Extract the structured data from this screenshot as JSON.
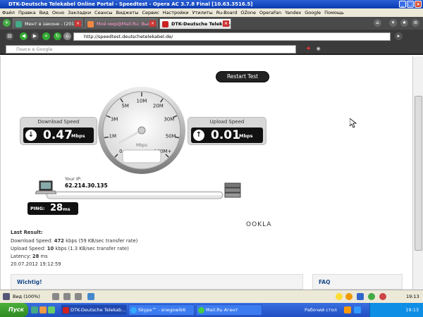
{
  "window": {
    "title": "DTK-Deutsche Telekabel Online Portal - Speedtest - Opera AC 3.7.8 Final [10.63.3516.5]"
  },
  "menu": [
    "Файл",
    "Правка",
    "Вид",
    "Окно",
    "Закладки",
    "Сеансы",
    "Виджеты",
    "Сервис",
    "Настройки",
    "Утилиты",
    "Ru-Board",
    "OZone",
    "OperaFan",
    "Yandex",
    "Google",
    "Помощь"
  ],
  "tabs": [
    {
      "label": "Мент в законе - (2010-..."
    },
    {
      "label": "Мой мир@Mail.Ru: Высок..."
    },
    {
      "label": "DTK-Deutsche Telekab..."
    }
  ],
  "address": {
    "url": "http://speedtest.deutschetelekabel.de/"
  },
  "search": {
    "placeholder": "Поиск в Google"
  },
  "speedtest": {
    "restart_label": "Restart Test",
    "download": {
      "label": "Download Speed",
      "value": "0.47",
      "unit": "Mbps"
    },
    "upload": {
      "label": "Upload Speed",
      "value": "0.01",
      "unit": "Mbps"
    },
    "gauge": {
      "ticks": [
        "0",
        "1M",
        "3M",
        "5M",
        "10M",
        "20M",
        "30M",
        "50M",
        "100M+"
      ],
      "unit": "Mbps",
      "needle_value": 0.47
    },
    "ip_label": "Your IP:",
    "ip": "62.214.30.135",
    "ping_label": "PING:",
    "ping_value": "28",
    "ping_unit": "ms",
    "brand": "OOKLA"
  },
  "result": {
    "title": "Last Result:",
    "download_prefix": "Download Speed:",
    "download_value": "472",
    "download_suffix": "kbps (59 KB/sec transfer rate)",
    "upload_prefix": "Upload Speed:",
    "upload_value": "10",
    "upload_suffix": "kbps (1.3 KB/sec transfer rate)",
    "latency_prefix": "Latency:",
    "latency_value": "28",
    "latency_suffix": "ms",
    "timestamp": "20.07.2012 19:12:59"
  },
  "boxes": {
    "wichtig": "Wichtig!",
    "faq": "FAQ"
  },
  "status": {
    "zoom": "Вид (100%)"
  },
  "taskbar": {
    "start": "Пуск",
    "buttons": [
      {
        "label": "DTK-Deutsche Telekab..."
      },
      {
        "label": "Skype™ - snegowik6"
      },
      {
        "label": "Mail.Ru Агент"
      }
    ],
    "desktop": "Рабочий стол",
    "clock": "19:13"
  },
  "colors": {
    "accent": "#1a4a8a",
    "panel": "#d8d8d8",
    "display": "#111111"
  }
}
